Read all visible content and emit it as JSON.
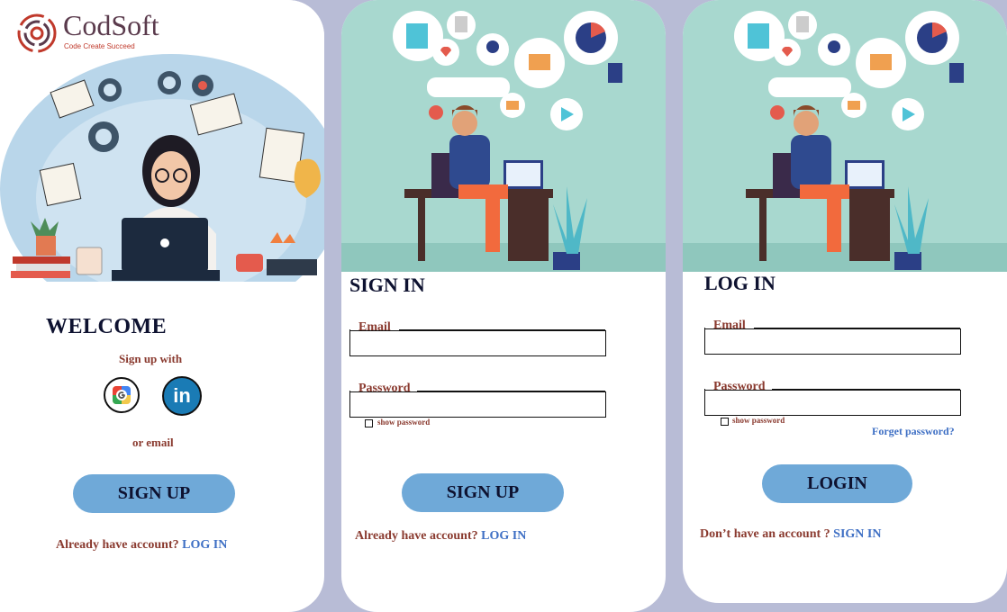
{
  "welcome_card": {
    "logo_text": "CodSoft",
    "logo_tagline": "Code Create Succeed",
    "heading": "WELCOME",
    "signup_with": "Sign up with",
    "or_email": "or email",
    "button": "SIGN UP",
    "footer_prefix": "Already have account?",
    "footer_link": "LOG IN"
  },
  "signin_card": {
    "title": "SIGN IN",
    "email_label": "Email",
    "password_label": "Password",
    "show_password": "show password",
    "button": "SIGN UP",
    "footer_prefix": "Already have account?",
    "footer_link": "LOG IN"
  },
  "login_card": {
    "title": "LOG IN",
    "email_label": "Email",
    "password_label": "Password",
    "show_password": "show password",
    "forgot": "Forget password?",
    "button": "LOGIN",
    "footer_prefix": "Don’t have an account ?",
    "footer_link": "SIGN IN"
  },
  "icons": {
    "google": "google-icon",
    "linkedin": "linkedin-icon",
    "linkedin_glyph": "in"
  },
  "colors": {
    "button": "#6fa9d8",
    "label": "#8a3a2f",
    "link": "#3e6fc4",
    "heading": "#0e1230",
    "background": "#b8bcd6"
  }
}
